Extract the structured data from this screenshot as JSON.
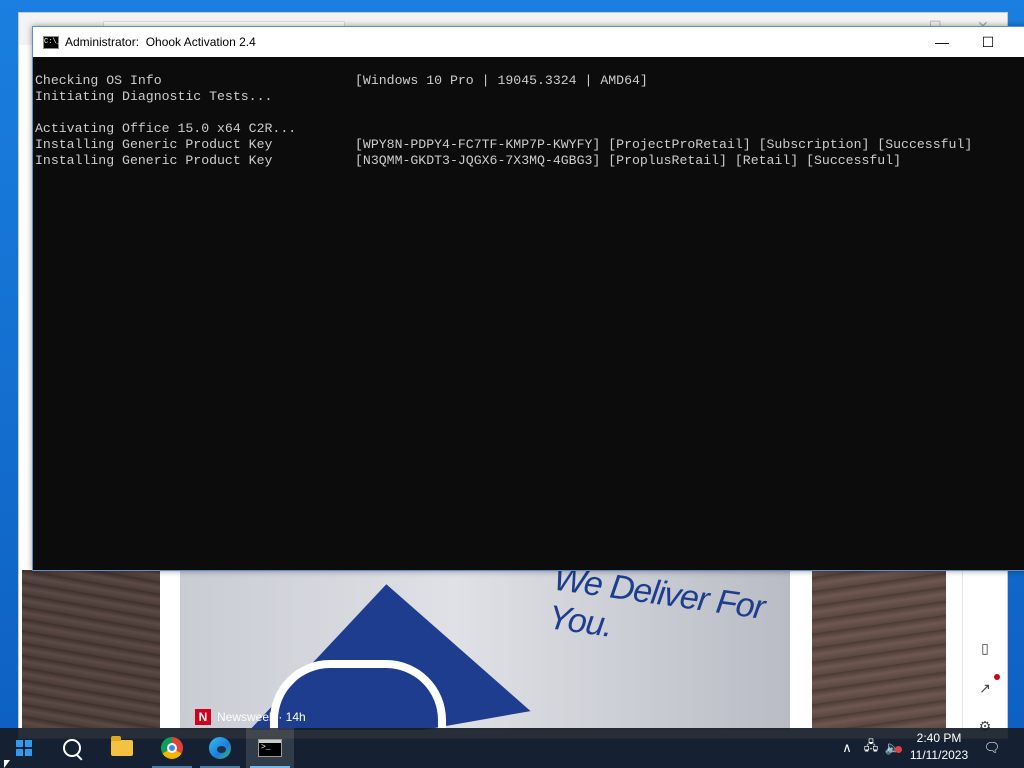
{
  "console": {
    "title": "Administrator:  Ohook Activation 2.4",
    "icon_label": "C:\\_",
    "lines": [
      {
        "label": "Checking OS Info",
        "value": "[Windows 10 Pro | 19045.3324 | AMD64]"
      },
      {
        "label": "Initiating Diagnostic Tests...",
        "value": ""
      },
      {
        "label": "",
        "value": ""
      },
      {
        "label": "Activating Office 15.0 x64 C2R...",
        "value": ""
      },
      {
        "label": "Installing Generic Product Key",
        "value": "[WPY8N-PDPY4-FC7TF-KMP7P-KWYFY] [ProjectProRetail] [Subscription] [Successful]"
      },
      {
        "label": "Installing Generic Product Key",
        "value": "[N3QMM-GKDT3-JQGX6-7X3MQ-4GBG3] [ProplusRetail] [Retail] [Successful]"
      }
    ],
    "minimize_glyph": "—",
    "maximize_glyph": "☐"
  },
  "news": {
    "slogan": "We Deliver For You.",
    "source_logo": "N",
    "source_label": "Newsweek · 14h"
  },
  "side_panel": {
    "split_icon": "▯",
    "open_icon": "↗",
    "settings_icon": "⚙"
  },
  "taskbar": {
    "items": [
      "start",
      "search",
      "file-explorer",
      "chrome",
      "edge",
      "command-prompt"
    ],
    "tray": {
      "chevron": "∧",
      "network": "🖧",
      "volume": "🔈",
      "notifications": "🗨"
    },
    "time": "2:40 PM",
    "date": "11/11/2023"
  },
  "colors": {
    "console_bg": "#0c0c0c",
    "console_text": "#cccccc",
    "taskbar_bg": "#161c26",
    "accent": "#76b9ed"
  }
}
